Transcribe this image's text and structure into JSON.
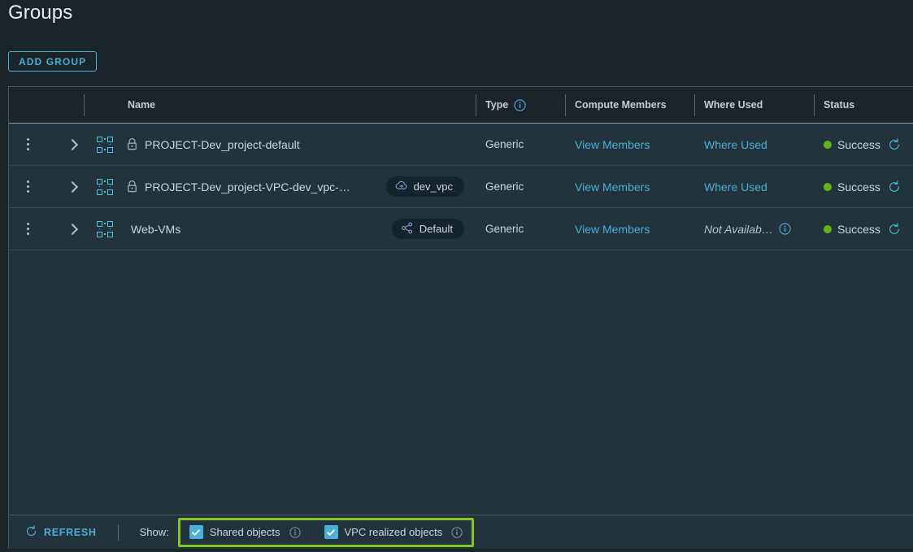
{
  "page": {
    "title": "Groups",
    "add_group_label": "ADD GROUP"
  },
  "colors": {
    "page_bg": "#1b2428",
    "table_bg": "#22333b",
    "accent_blue": "#4aaed9",
    "icon_cyan": "#4cc2e8",
    "status_green": "#60b515",
    "highlight_green": "#84c724",
    "text_primary": "#cdd6dc",
    "header_text": "#c3cdd4"
  },
  "table": {
    "columns": [
      {
        "key": "actions",
        "label": ""
      },
      {
        "key": "expand",
        "label": ""
      },
      {
        "key": "group_icon",
        "label": ""
      },
      {
        "key": "name",
        "label": "Name"
      },
      {
        "key": "type",
        "label": "Type",
        "info": true
      },
      {
        "key": "compute_members",
        "label": "Compute Members"
      },
      {
        "key": "where_used",
        "label": "Where Used"
      },
      {
        "key": "status",
        "label": "Status"
      }
    ],
    "rows": [
      {
        "name": "PROJECT-Dev_project-default",
        "locked": true,
        "badge": null,
        "badge_icon": null,
        "type": "Generic",
        "compute_members": "View Members",
        "where_used": "Where Used",
        "where_used_available": true,
        "status": "Success"
      },
      {
        "name": "PROJECT-Dev_project-VPC-dev_vpc-…",
        "locked": true,
        "badge": "dev_vpc",
        "badge_icon": "cloud-vpc-icon",
        "type": "Generic",
        "compute_members": "View Members",
        "where_used": "Where Used",
        "where_used_available": true,
        "status": "Success"
      },
      {
        "name": "Web-VMs",
        "locked": false,
        "badge": "Default",
        "badge_icon": "share-nodes-icon",
        "type": "Generic",
        "compute_members": "View Members",
        "where_used": "Not Availab…",
        "where_used_available": false,
        "status": "Success"
      }
    ]
  },
  "footer": {
    "refresh_label": "REFRESH",
    "show_label": "Show:",
    "filters": [
      {
        "label": "Shared objects",
        "checked": true,
        "info": true
      },
      {
        "label": "VPC realized objects",
        "checked": true,
        "info": true
      }
    ]
  }
}
